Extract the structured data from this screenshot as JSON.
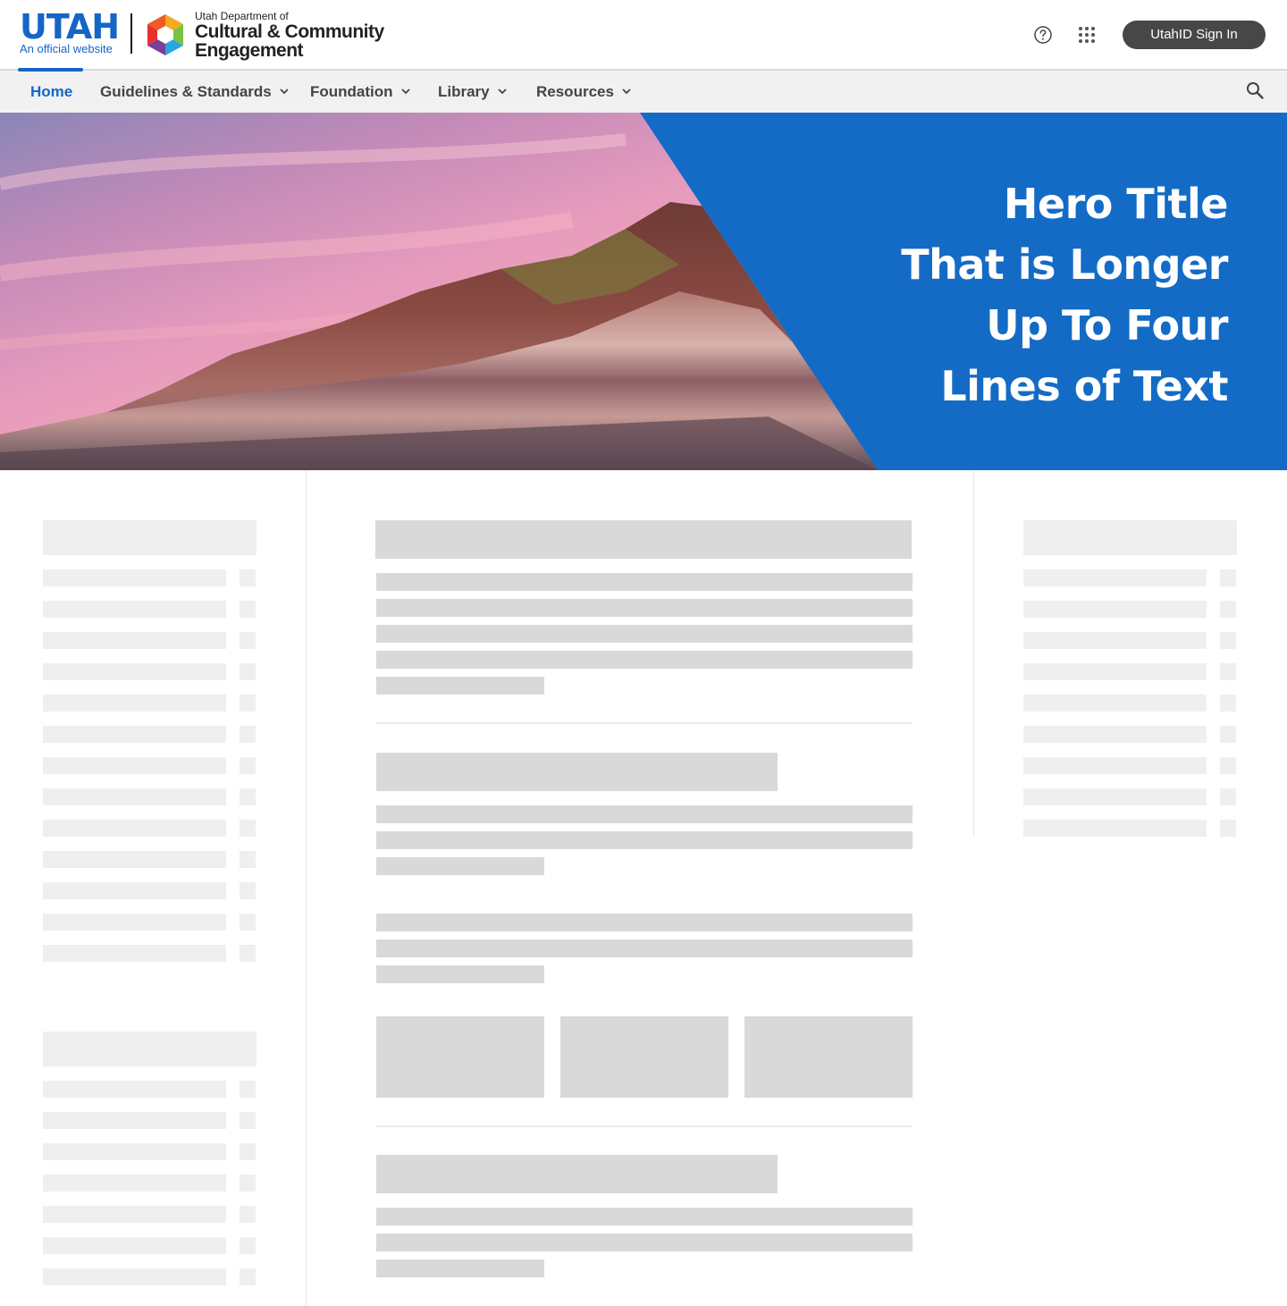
{
  "header": {
    "utah_word": "UTAH",
    "utah_tagline": "An official website",
    "agency": {
      "line1": "Utah Department of",
      "line2": "Cultural & Community",
      "line3": "Engagement"
    },
    "help_icon": "question-circle-icon",
    "apps_icon": "grid-apps-icon",
    "signin_label": "UtahID Sign In"
  },
  "nav": {
    "items": [
      {
        "label": "Home",
        "active": true
      },
      {
        "label": "Guidelines & Standards",
        "has_menu": true
      },
      {
        "label": "Foundation",
        "has_menu": true
      },
      {
        "label": "Library",
        "has_menu": true
      },
      {
        "label": "Resources",
        "has_menu": true
      }
    ],
    "search_icon": "search-icon"
  },
  "hero": {
    "title_lines": [
      "Hero Title",
      "That is Longer",
      "Up To Four",
      "Lines of Text"
    ],
    "image": "desert-cliffs-sunset-photo"
  },
  "colors": {
    "brand_blue": "#1565c6",
    "hero_blue": "#146bc5",
    "signin_bg": "#474747",
    "skeleton": "#d9d9d9",
    "skeleton_light": "#efefef"
  }
}
